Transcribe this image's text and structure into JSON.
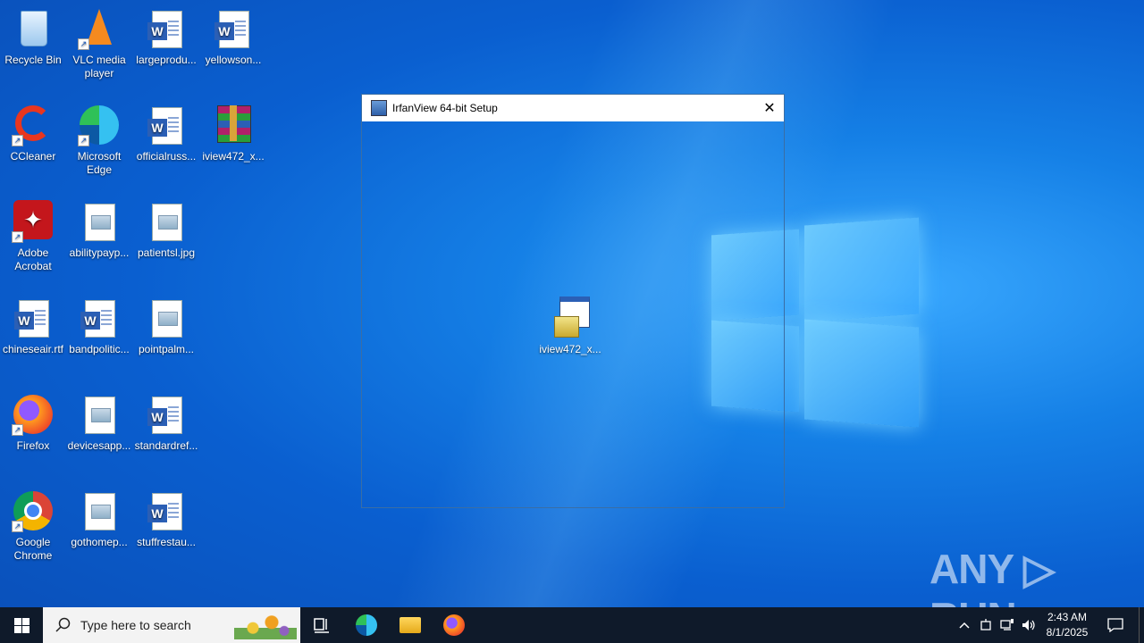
{
  "desktop": {
    "icons": [
      {
        "label": "Recycle Bin"
      },
      {
        "label": "VLC media player"
      },
      {
        "label": "largeprodu..."
      },
      {
        "label": "yellowson..."
      },
      {
        "label": "CCleaner"
      },
      {
        "label": "Microsoft Edge"
      },
      {
        "label": "officialruss..."
      },
      {
        "label": "iview472_x..."
      },
      {
        "label": "Adobe Acrobat"
      },
      {
        "label": "abilitypayp..."
      },
      {
        "label": "patientsl.jpg"
      },
      {
        "label": "chineseair.rtf"
      },
      {
        "label": "bandpolitic..."
      },
      {
        "label": "pointpalm..."
      },
      {
        "label": "Firefox"
      },
      {
        "label": "devicesapp..."
      },
      {
        "label": "standardref..."
      },
      {
        "label": "Google Chrome"
      },
      {
        "label": "gothomep..."
      },
      {
        "label": "stuffrestau..."
      }
    ]
  },
  "dialog": {
    "title": "IrfanView 64-bit Setup",
    "close_label": "✕",
    "icon_label": "iview472_x..."
  },
  "watermark": "ANY ▷ RUN",
  "taskbar": {
    "search_placeholder": "Type here to search",
    "time": "2:43 AM",
    "date": "8/1/2025"
  },
  "icons": {
    "start": "windows-icon",
    "search": "search-icon",
    "task_view": "task-view-icon",
    "edge": "edge-icon",
    "explorer": "folder-icon",
    "firefox": "firefox-icon"
  }
}
